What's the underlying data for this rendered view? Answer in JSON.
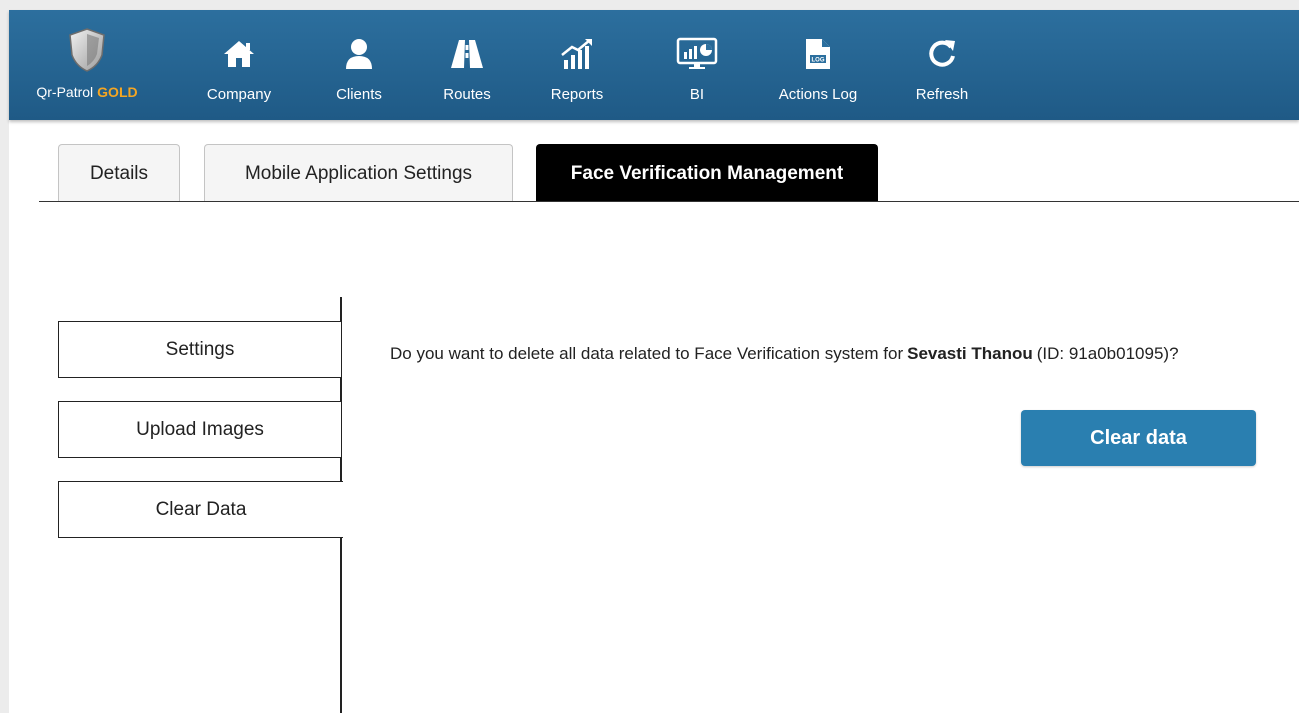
{
  "navbar": {
    "brand": {
      "name": "Qr-Patrol",
      "tier": "GOLD",
      "icon": "shield-icon"
    },
    "items": [
      {
        "label": "Company",
        "icon": "home-icon"
      },
      {
        "label": "Clients",
        "icon": "user-icon"
      },
      {
        "label": "Routes",
        "icon": "road-icon"
      },
      {
        "label": "Reports",
        "icon": "chart-icon"
      },
      {
        "label": "BI",
        "icon": "monitor-chart-icon"
      },
      {
        "label": "Actions Log",
        "icon": "log-file-icon"
      },
      {
        "label": "Refresh",
        "icon": "refresh-icon"
      }
    ]
  },
  "tabs": [
    {
      "label": "Details",
      "active": false
    },
    {
      "label": "Mobile Application Settings",
      "active": false
    },
    {
      "label": "Face Verification Management",
      "active": true
    }
  ],
  "side_menu": [
    {
      "label": "Settings",
      "active": false
    },
    {
      "label": "Upload Images",
      "active": false
    },
    {
      "label": "Clear Data",
      "active": true
    }
  ],
  "content": {
    "question_prefix": "Do you want to delete all data related to Face Verification system for",
    "person_name": "Sevasti Thanou",
    "question_suffix": "(ID: 91a0b01095)?",
    "clear_button": "Clear data"
  },
  "colors": {
    "navbar": "#2c6f9e",
    "accent_gold": "#f5a623",
    "button": "#2a7fb0",
    "active_tab": "#000000"
  }
}
